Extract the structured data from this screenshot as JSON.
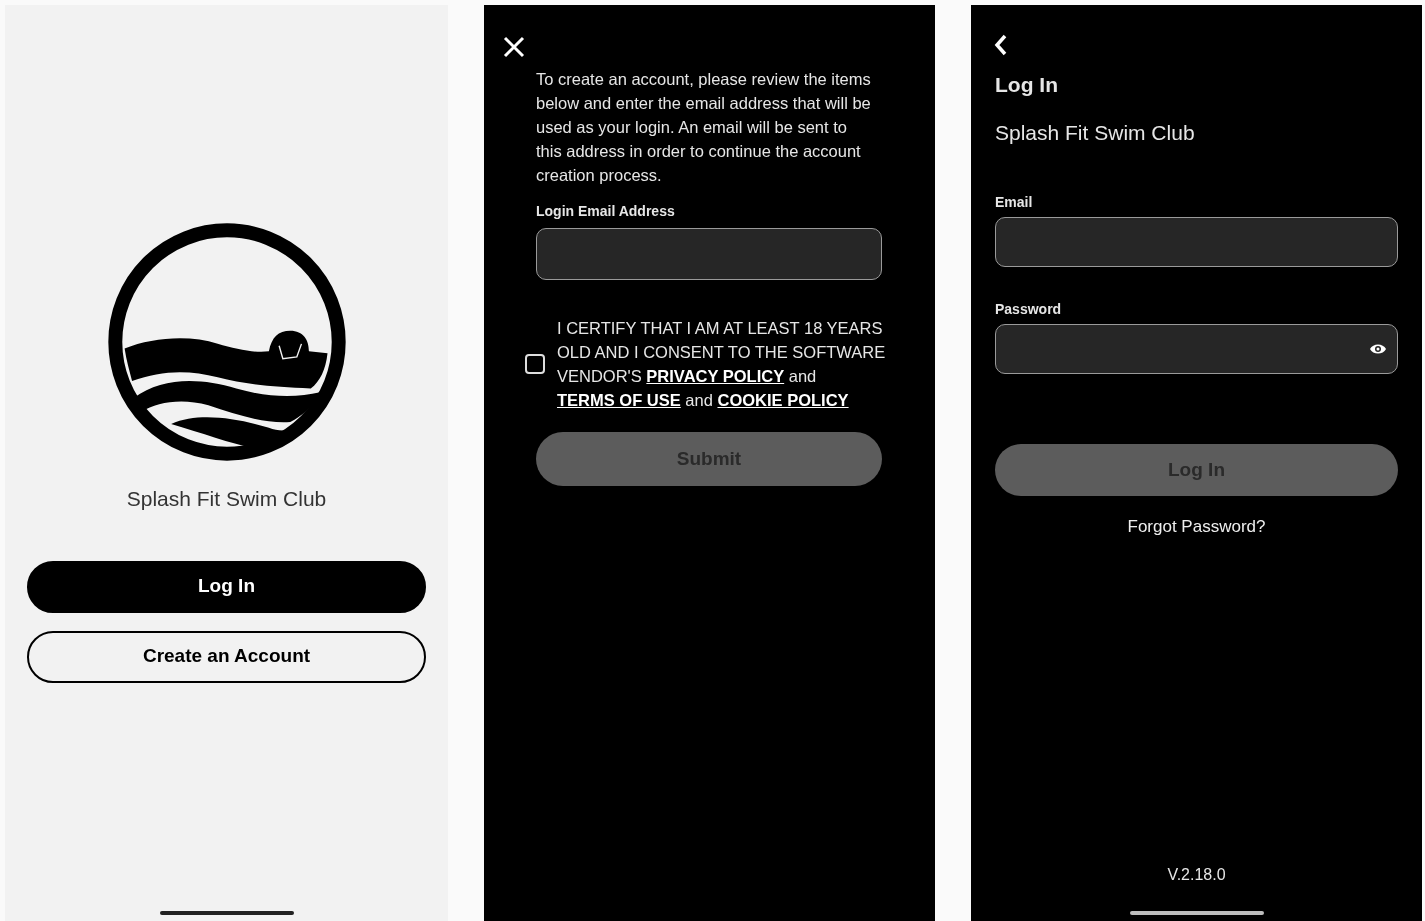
{
  "screens": [
    {
      "kind": "welcome",
      "title": "Splash Fit Swim Club",
      "buttons": [
        {
          "label": "Log In",
          "kind": "primary"
        },
        {
          "label": "Create an Account",
          "kind": "outline"
        }
      ]
    },
    {
      "kind": "signup",
      "intro": "To create an account, please review the items below and enter the email address that will be used as your login. An email will be sent to this address in order to continue the account creation process.",
      "email_label": "Login Email Address",
      "consent": {
        "checked": false,
        "parts": [
          {
            "kind": "text",
            "text": "I CERTIFY THAT I AM AT LEAST 18 YEARS OLD AND I CONSENT TO THE SOFTWARE VENDOR'S "
          },
          {
            "kind": "link",
            "text": "PRIVACY POLICY"
          },
          {
            "kind": "text",
            "text": " and "
          },
          {
            "kind": "link",
            "text": "TERMS OF USE"
          },
          {
            "kind": "text",
            "text": " and "
          },
          {
            "kind": "link",
            "text": "COOKIE POLICY"
          }
        ]
      },
      "submit": {
        "label": "Submit",
        "disabled": true
      }
    },
    {
      "kind": "login",
      "heading": "Log In",
      "subtitle": "Splash Fit Swim Club",
      "fields": [
        {
          "label": "Email",
          "kind": "text"
        },
        {
          "label": "Password",
          "kind": "password"
        }
      ],
      "submit": {
        "label": "Log In",
        "disabled": true
      },
      "forgot": "Forgot Password?",
      "version": "V.2.18.0"
    }
  ]
}
